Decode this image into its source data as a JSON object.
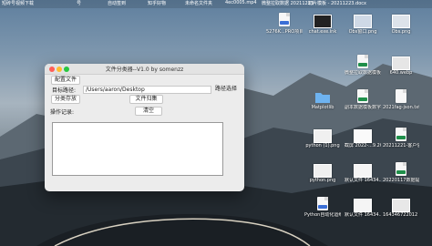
{
  "top_labels": [
    "短砖号视频下载",
    "号",
    "自动签到",
    "知乎好物",
    "未命名文件夹",
    "4ec0005.mp4",
    "微整拉取数据 20211223",
    "切片模板 - 20211223.docx"
  ],
  "window": {
    "title": "文件分类器--V1.0 by somenzz",
    "config_button": "配置文件",
    "target_label": "目标路径:",
    "target_path": "/Users/aaron/Desktop",
    "choose_path_button": "路径选择",
    "category_button": "分类存放",
    "file_return_button": "文件归集",
    "log_label": "操作记录:",
    "clear_button": "清空"
  },
  "desktop_icons": [
    {
      "label": "5276K...PRO项目.docx"
    },
    {
      "label": "chat.exe.lnk"
    },
    {
      "label": "Obs窗口.png"
    },
    {
      "label": "Obs.png"
    },
    {
      "label": "微整拉取数据模板合集.xlsx"
    },
    {
      "label": "640.webp"
    },
    {
      "label": "Matplotlib"
    },
    {
      "label": "副本数据模板数字-问题...群.xlsx"
    },
    {
      "label": "2021fag-json.txt"
    },
    {
      "label": "python (1).png"
    },
    {
      "label": "截屏 2022-...9.20.59"
    },
    {
      "label": "20211221-客户信息表...表.xlsx"
    },
    {
      "label": "python.png"
    },
    {
      "label": "默认文件 16434...66.png"
    },
    {
      "label": "20220117数据提取结果.xlsx"
    },
    {
      "label": "Python自动化运维-新增.doc"
    },
    {
      "label": "默认文件 16434...62.png"
    },
    {
      "label": "164346722012 2.jpg"
    }
  ]
}
